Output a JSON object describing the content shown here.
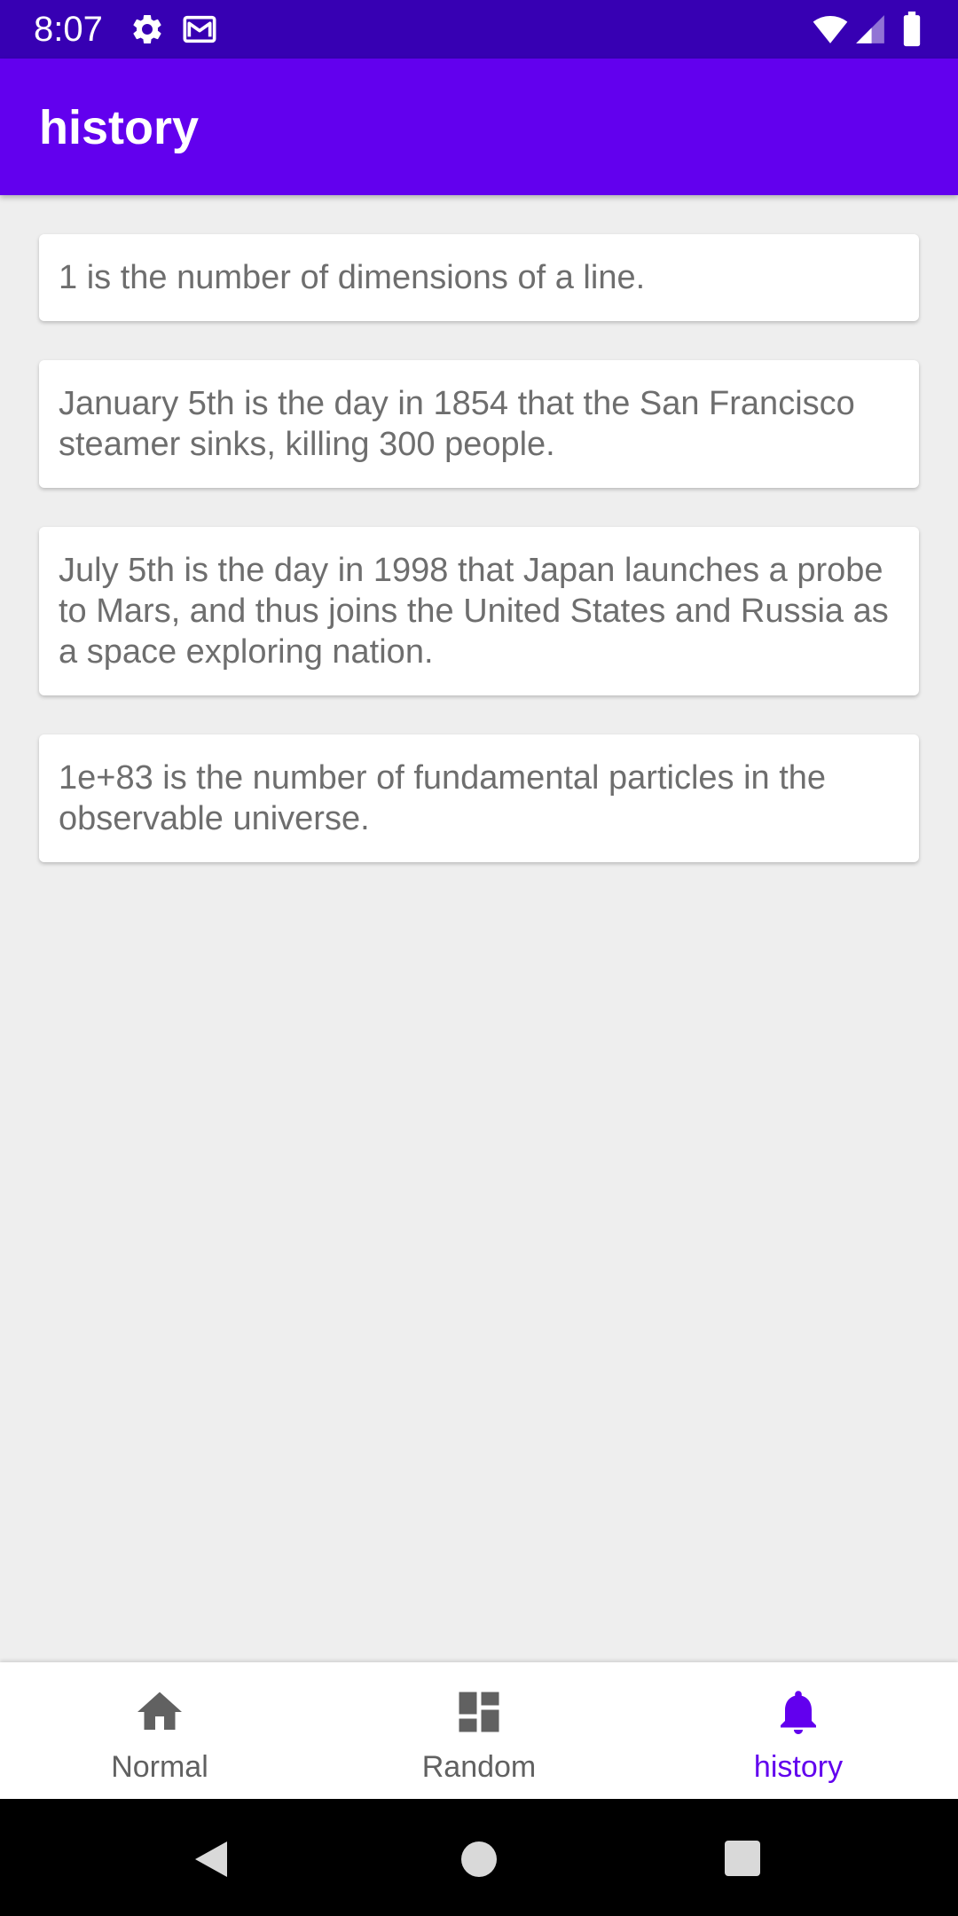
{
  "status_bar": {
    "time": "8:07",
    "icons": [
      "gear-icon",
      "gmail-icon",
      "wifi-icon",
      "signal-icon",
      "battery-icon"
    ]
  },
  "app_bar": {
    "title": "history",
    "color": "#6200ee"
  },
  "history_items": [
    "1 is the number of dimensions of a line.",
    "January 5th is the day in 1854 that the San Francisco steamer sinks, killing 300 people.",
    "July 5th is the day in 1998 that Japan launches a probe to Mars, and thus joins the United States and Russia as a space exploring nation.",
    "1e+83 is the number of fundamental particles in the observable universe."
  ],
  "bottom_nav": {
    "items": [
      {
        "label": "Normal",
        "icon": "home-icon",
        "active": false
      },
      {
        "label": "Random",
        "icon": "dashboard-icon",
        "active": false
      },
      {
        "label": "history",
        "icon": "bell-icon",
        "active": true
      }
    ],
    "active_color": "#6200ee",
    "inactive_color": "#616161"
  },
  "system_nav": {
    "buttons": [
      "back-icon",
      "home-circle-icon",
      "recents-icon"
    ]
  }
}
